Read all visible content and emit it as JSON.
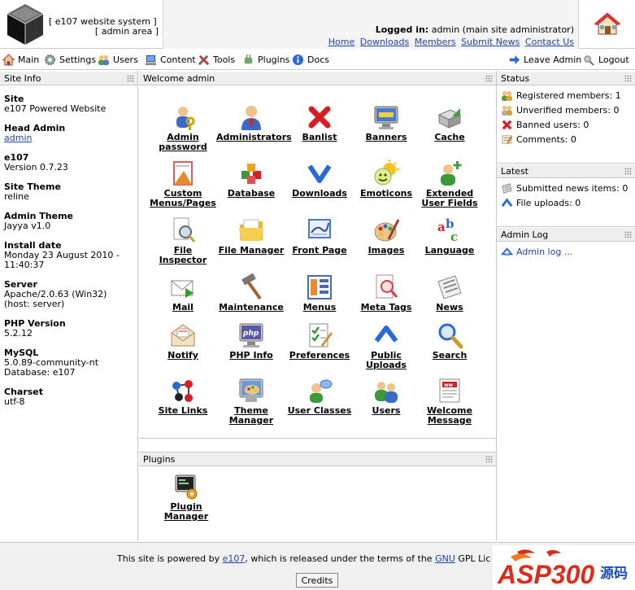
{
  "header": {
    "system_line1": "[ e107 website system ]",
    "system_line2": "[ admin area ]",
    "logged_in_label": "Logged in:",
    "logged_in_user": "admin (main site administrator)",
    "links": [
      "Home",
      "Downloads",
      "Members",
      "Submit News",
      "Contact Us"
    ]
  },
  "nav": {
    "left": [
      {
        "label": "Main",
        "icon": "home-icon"
      },
      {
        "label": "Settings",
        "icon": "gear-icon"
      },
      {
        "label": "Users",
        "icon": "users-icon"
      },
      {
        "label": "Content",
        "icon": "content-icon"
      },
      {
        "label": "Tools",
        "icon": "tools-icon"
      },
      {
        "label": "Plugins",
        "icon": "plugin-icon"
      },
      {
        "label": "Docs",
        "icon": "info-icon"
      }
    ],
    "right": [
      {
        "label": "Leave Admin",
        "icon": "arrow-icon"
      },
      {
        "label": "Logout",
        "icon": "logout-icon"
      }
    ]
  },
  "site_info": {
    "caption": "Site Info",
    "site_label": "Site",
    "site_value": "e107 Powered Website",
    "head_admin_label": "Head Admin",
    "head_admin_value": "admin",
    "e107_label": "e107",
    "e107_value": "Version 0.7.23",
    "theme_label": "Site Theme",
    "theme_value": "reline",
    "admin_theme_label": "Admin Theme",
    "admin_theme_value": "Jayya v1.0",
    "install_label": "Install date",
    "install_value1": "Monday 23 August 2010 -",
    "install_value2": "11:40:37",
    "server_label": "Server",
    "server_value1": "Apache/2.0.63 (Win32)",
    "server_value2": "(host: server)",
    "php_label": "PHP Version",
    "php_value": "5.2.12",
    "mysql_label": "MySQL",
    "mysql_value1": "5.0.89-community-nt",
    "mysql_value2": "Database: e107",
    "charset_label": "Charset",
    "charset_value": "utf-8"
  },
  "welcome": {
    "caption": "Welcome admin",
    "items": [
      {
        "l1": "Admin",
        "l2": "password",
        "icon": "key-user-icon"
      },
      {
        "l1": "Administrators",
        "l2": "",
        "icon": "administrator-icon"
      },
      {
        "l1": "Banlist",
        "l2": "",
        "icon": "ban-x-icon"
      },
      {
        "l1": "Banners",
        "l2": "",
        "icon": "banner-monitor-icon"
      },
      {
        "l1": "Cache",
        "l2": "",
        "icon": "cache-icon"
      },
      {
        "l1": "Custom",
        "l2": "Menus/Pages",
        "icon": "custom-menu-icon"
      },
      {
        "l1": "Database",
        "l2": "",
        "icon": "database-icon"
      },
      {
        "l1": "Downloads",
        "l2": "",
        "icon": "download-arrow-icon"
      },
      {
        "l1": "Emoticons",
        "l2": "",
        "icon": "emoticon-icon"
      },
      {
        "l1": "Extended",
        "l2": "User Fields",
        "icon": "user-plus-icon"
      },
      {
        "l1": "File",
        "l2": "Inspector",
        "icon": "file-magnifier-icon"
      },
      {
        "l1": "File Manager",
        "l2": "",
        "icon": "folder-icon"
      },
      {
        "l1": "Front Page",
        "l2": "",
        "icon": "front-page-icon"
      },
      {
        "l1": "Images",
        "l2": "",
        "icon": "palette-icon"
      },
      {
        "l1": "Language",
        "l2": "",
        "icon": "abc-icon"
      },
      {
        "l1": "Mail",
        "l2": "",
        "icon": "mail-icon"
      },
      {
        "l1": "Maintenance",
        "l2": "",
        "icon": "hammer-icon"
      },
      {
        "l1": "Menus",
        "l2": "",
        "icon": "menus-icon"
      },
      {
        "l1": "Meta Tags",
        "l2": "",
        "icon": "meta-tags-icon"
      },
      {
        "l1": "News",
        "l2": "",
        "icon": "news-icon"
      },
      {
        "l1": "Notify",
        "l2": "",
        "icon": "notify-envelope-icon"
      },
      {
        "l1": "PHP Info",
        "l2": "",
        "icon": "php-monitor-icon"
      },
      {
        "l1": "Preferences",
        "l2": "",
        "icon": "checklist-icon"
      },
      {
        "l1": "Public",
        "l2": "Uploads",
        "icon": "upload-arrow-icon"
      },
      {
        "l1": "Search",
        "l2": "",
        "icon": "search-icon"
      },
      {
        "l1": "Site Links",
        "l2": "",
        "icon": "site-links-icon"
      },
      {
        "l1": "Theme",
        "l2": "Manager",
        "icon": "theme-icon"
      },
      {
        "l1": "User Classes",
        "l2": "",
        "icon": "user-classes-icon"
      },
      {
        "l1": "Users",
        "l2": "",
        "icon": "users-icon"
      },
      {
        "l1": "Welcome",
        "l2": "Message",
        "icon": "welcome-message-icon"
      }
    ]
  },
  "plugins": {
    "caption": "Plugins",
    "items": [
      {
        "l1": "Plugin",
        "l2": "Manager",
        "icon": "plugin-manager-icon"
      }
    ]
  },
  "status": {
    "caption": "Status",
    "rows": [
      {
        "text": "Registered members: 1",
        "icon": "members-icon"
      },
      {
        "text": "Unverified members: 0",
        "icon": "unverified-icon"
      },
      {
        "text": "Banned users: 0",
        "icon": "ban-x-icon"
      },
      {
        "text": "Comments: 0",
        "icon": "comment-icon"
      }
    ]
  },
  "latest": {
    "caption": "Latest",
    "rows": [
      {
        "text": "Submitted news items: 0",
        "icon": "news-icon"
      },
      {
        "text": "File uploads: 0",
        "icon": "upload-arrow-icon"
      }
    ]
  },
  "admin_log": {
    "caption": "Admin Log",
    "link": "Admin log ..."
  },
  "footer": {
    "text_before": "This site is powered by ",
    "e107_link": "e107",
    "text_middle": ", which is released under the terms of the ",
    "gnu_link": "GNU",
    "text_after": " GPL Lic",
    "credits_label": "Credits"
  },
  "watermark": {
    "main": "ASP300",
    "sub": "源码"
  },
  "colors": {
    "link": "#2244aa",
    "caption_bg": "#eeeeee",
    "watermark_red": "#e02a1a",
    "watermark_blue": "#1d4fb3"
  }
}
